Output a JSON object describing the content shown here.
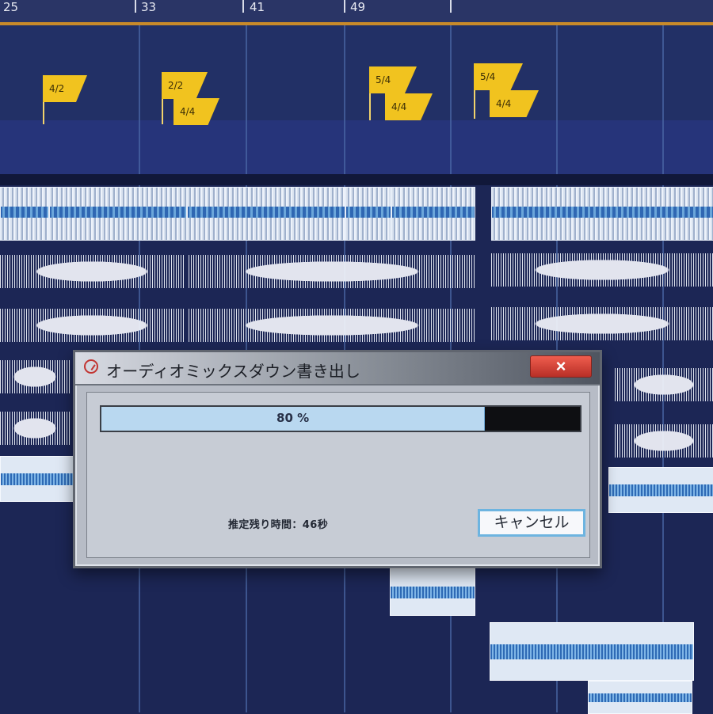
{
  "timeline": {
    "ruler_numbers": [
      "25",
      "33",
      "41",
      "49"
    ],
    "signature_markers": [
      "4/2",
      "2/2",
      "4/4",
      "5/4",
      "4/4",
      "5/4",
      "4/4"
    ]
  },
  "dialog": {
    "title": "オーディオミックスダウン書き出し",
    "close_label": "×",
    "progress": {
      "value": 0.8,
      "text": "80 %"
    },
    "remaining_text": "推定残り時間：46秒",
    "cancel_label": "キャンセル",
    "icon_name": "cubase-logo-icon",
    "close_icon_name": "close-icon"
  },
  "colors": {
    "background": "#1c2655",
    "marker": "#f1c31f",
    "waveform": "#eef2fa",
    "progress": "#b9d8f0",
    "close": "#d43a30"
  }
}
